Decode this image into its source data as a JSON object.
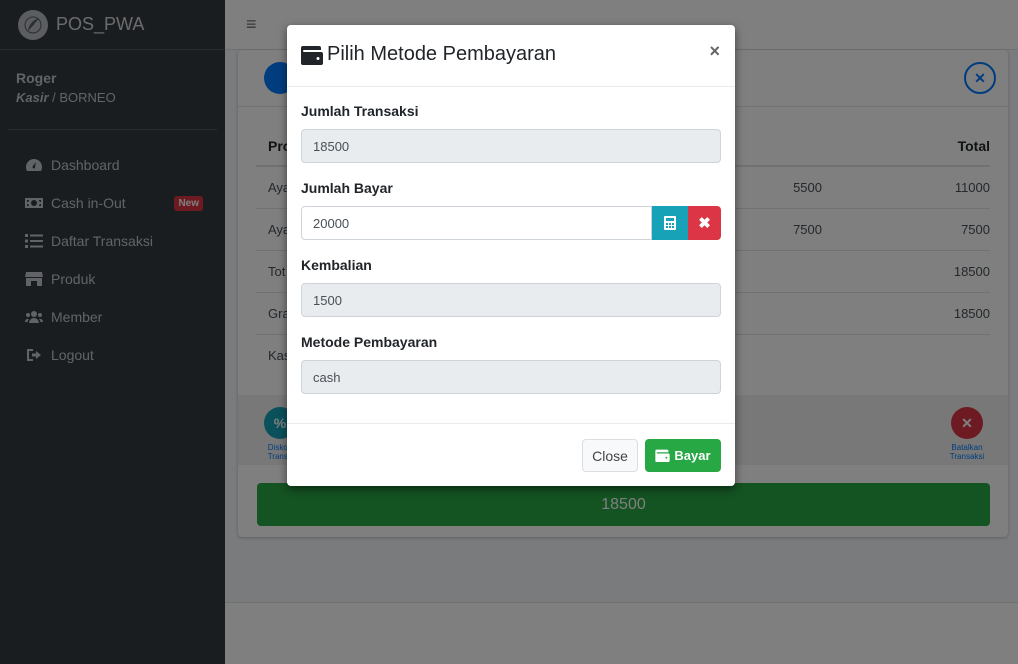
{
  "sidebar": {
    "brand": "POS_PWA",
    "user_name": "Roger",
    "user_role": "Kasir",
    "user_branch": " / BORNEO",
    "items": [
      {
        "label": "Dashboard",
        "icon": "tachometer-icon"
      },
      {
        "label": "Cash in-Out",
        "icon": "money-bill-icon",
        "badge": "New"
      },
      {
        "label": "Daftar Transaksi",
        "icon": "list-icon"
      },
      {
        "label": "Produk",
        "icon": "store-icon"
      },
      {
        "label": "Member",
        "icon": "users-icon"
      },
      {
        "label": "Logout",
        "icon": "sign-out-icon"
      }
    ]
  },
  "topbar": {
    "menu_icon": "≡"
  },
  "card": {
    "table": {
      "header": {
        "col1": "Pro",
        "col4": "Total"
      },
      "rows": [
        {
          "col1": "Aya",
          "col3": "5500",
          "col4": "11000"
        },
        {
          "col1": "Aya",
          "col3": "7500",
          "col4": "7500"
        },
        {
          "col1": "Tot",
          "col3": "",
          "col4": "18500"
        },
        {
          "col1": "Gra",
          "col3": "",
          "col4": "18500"
        },
        {
          "col1": "Kas",
          "col3": "",
          "col4": ""
        }
      ]
    },
    "actions": {
      "diskon_label": "Diskon Transa",
      "batal_label": "Batalkan Transaksi"
    },
    "total": "18500"
  },
  "modal": {
    "title": "Pilih Metode Pembayaran",
    "close_x": "×",
    "jumlah_transaksi_label": "Jumlah Transaksi",
    "jumlah_transaksi_value": "18500",
    "jumlah_bayar_label": "Jumlah Bayar",
    "jumlah_bayar_value": "20000",
    "kembalian_label": "Kembalian",
    "kembalian_value": "1500",
    "metode_label": "Metode Pembayaran",
    "metode_value": "cash",
    "close_button": "Close",
    "bayar_button": "Bayar"
  },
  "colors": {
    "sidebar_bg": "#343a40",
    "primary": "#007bff",
    "success": "#28a745",
    "danger": "#dc3545",
    "info": "#17a2b8"
  }
}
